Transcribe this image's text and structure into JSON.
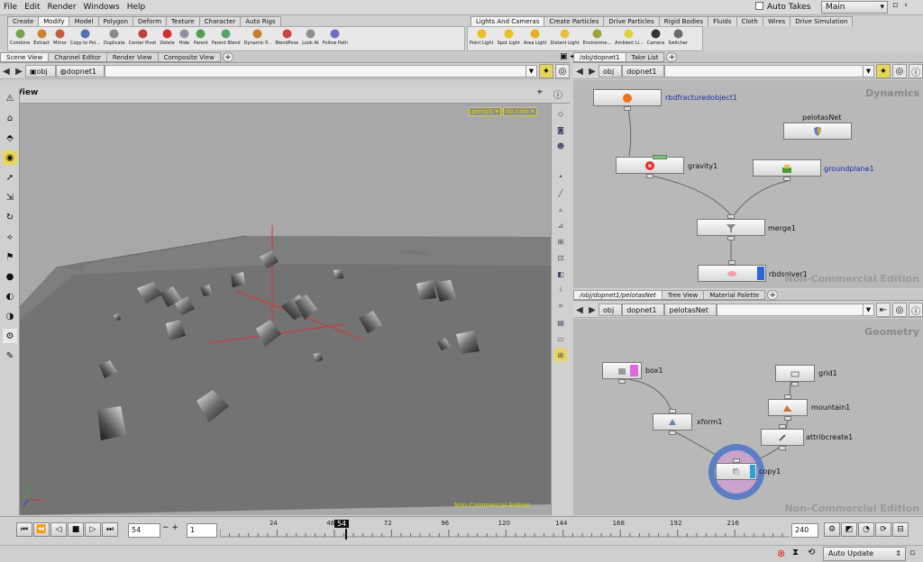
{
  "menu": [
    "File",
    "Edit",
    "Render",
    "Windows",
    "Help"
  ],
  "take": {
    "auto_takes": "Auto Takes",
    "current": "Main"
  },
  "shelf_left": {
    "tabs": [
      "Create",
      "Modify",
      "Model",
      "Polygon",
      "Deform",
      "Texture",
      "Character",
      "Auto Rigs"
    ],
    "tools": [
      "Combine",
      "Extract",
      "Mirror",
      "Copy to Poi...",
      "Duplicate",
      "Center Pivot",
      "Delete",
      "Hide",
      "Parent",
      "Parent Blend",
      "Dynamic P...",
      "BlendPose",
      "Look At",
      "Follow Path"
    ]
  },
  "shelf_right": {
    "tabs": [
      "Lights And Cameras",
      "Create Particles",
      "Drive Particles",
      "Rigid Bodies",
      "Fluids",
      "Cloth",
      "Wires",
      "Drive Simulation"
    ],
    "tools": [
      "Point Light",
      "Spot Light",
      "Area Light",
      "Distant Light",
      "Environme...",
      "Ambient Li...",
      "Camera",
      "Switcher"
    ]
  },
  "scene_tabs": [
    "Scene View",
    "Channel Editor",
    "Render View",
    "Composite View"
  ],
  "scene_path": [
    "obj",
    "dopnet1"
  ],
  "view_label": "View",
  "cams": [
    "persp1",
    "no cam"
  ],
  "viewport_watermark": "Non-Commercial Edition",
  "dyn_tabs": [
    "/obj/dopnet1",
    "Take List"
  ],
  "dyn_path": [
    "obj",
    "dopnet1"
  ],
  "dyn_title": "Dynamics",
  "dyn_nodes": [
    "rbdfracturedobject1",
    "pelotasNet",
    "gravity1",
    "groundplane1",
    "merge1",
    "rbdsolver1"
  ],
  "geo_tabs": [
    "/obj/dopnet1/pelotasNet",
    "Tree View",
    "Material Palette"
  ],
  "geo_path": [
    "obj",
    "dopnet1",
    "pelotasNet"
  ],
  "geo_title": "Geometry",
  "geo_nodes": [
    "box1",
    "grid1",
    "mountain1",
    "xform1",
    "attribcreate1",
    "copy1"
  ],
  "nc_watermark": "Non-Commercial Edition",
  "timeline": {
    "current": "54",
    "start": "1",
    "end": "240",
    "ticks": [
      "24",
      "48",
      "72",
      "96",
      "120",
      "144",
      "168",
      "192",
      "216"
    ]
  },
  "auto_update": "Auto Update",
  "colors": {
    "accent": "#e8d65b",
    "node_blue": "#1a2ea0",
    "cam_label": "#d8d800",
    "selection": "#5c7ec4"
  }
}
